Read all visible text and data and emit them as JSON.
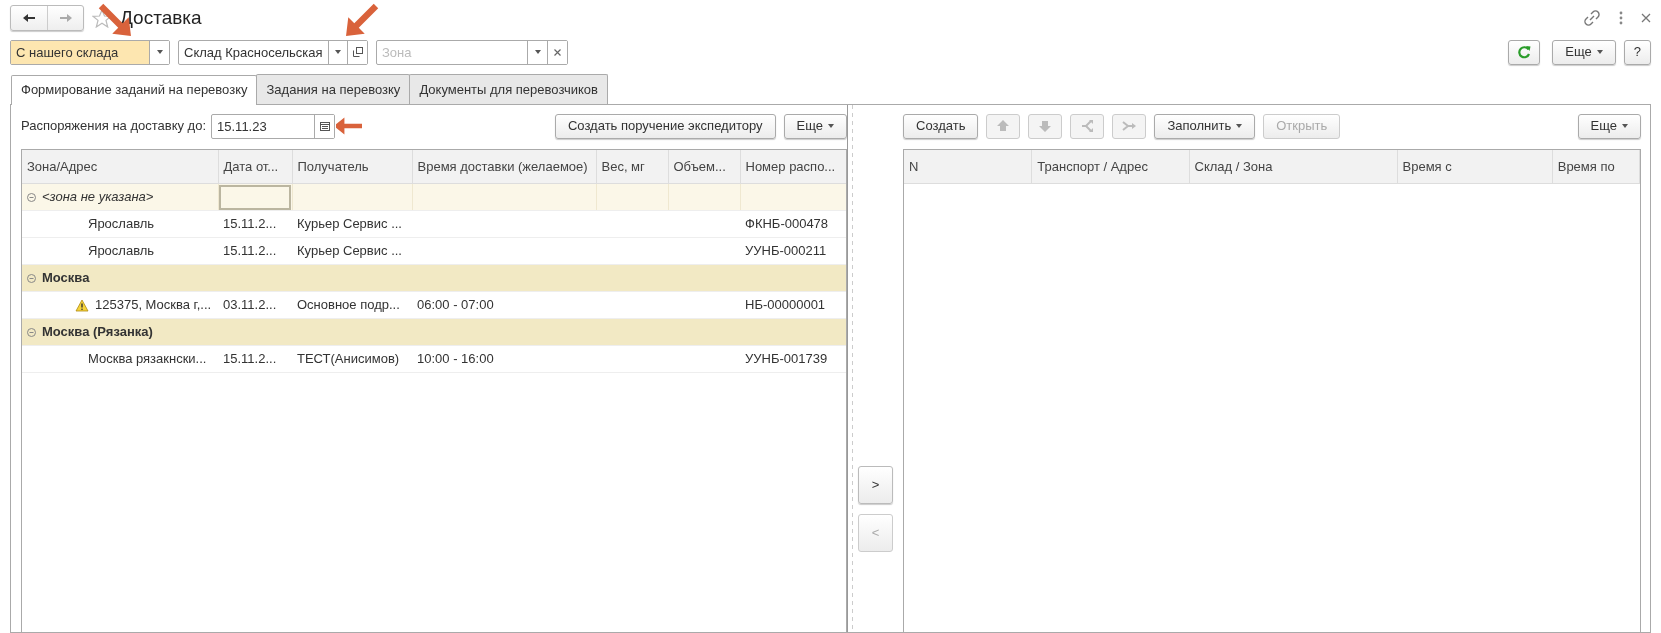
{
  "window": {
    "title": "Доставка",
    "back_enabled": true,
    "forward_enabled": false
  },
  "filters": [
    {
      "kind": "select",
      "value": "С нашего склада",
      "highlighted": true
    },
    {
      "kind": "select-open",
      "value": "Склад Красносельская",
      "highlighted": false
    },
    {
      "kind": "select-clear",
      "placeholder": "Зона",
      "highlighted": false
    }
  ],
  "top_buttons": {
    "more": "Еще",
    "help": "?"
  },
  "tabs": [
    {
      "label": "Формирование заданий на перевозку",
      "selected": true
    },
    {
      "label": "Задания на перевозку",
      "selected": false
    },
    {
      "label": "Документы для перевозчиков",
      "selected": false
    }
  ],
  "orders": {
    "date_label": "Распоряжения на доставку до:",
    "date_value": "15.11.23",
    "create_button": "Создать поручение экспедитору",
    "more": "Еще",
    "table": {
      "columns": [
        "Зона/Адрес",
        "Дата от...",
        "Получатель",
        "Время доставки (желаемое)",
        "Вес, мг",
        "Объем...",
        "Номер распо..."
      ],
      "rows": [
        {
          "kind": "unspecified-group",
          "selected": true,
          "cells": [
            "<зона не указана>"
          ]
        },
        {
          "kind": "item",
          "warning": false,
          "cells": [
            "Ярославль",
            "15.11.2...",
            "Курьер Сервис ...",
            "",
            "",
            "",
            "ФКНБ-000478"
          ]
        },
        {
          "kind": "item",
          "warning": false,
          "cells": [
            "Ярославль",
            "15.11.2...",
            "Курьер Сервис ...",
            "",
            "",
            "",
            "УУНБ-000211"
          ]
        },
        {
          "kind": "group",
          "selected": false,
          "cells": [
            "Москва"
          ]
        },
        {
          "kind": "item",
          "warning": true,
          "cells": [
            "125375, Москва г,...",
            "03.11.2...",
            "Основное подр...",
            "06:00 - 07:00",
            "",
            "",
            "НБ-00000001"
          ]
        },
        {
          "kind": "group",
          "selected": false,
          "cells": [
            "Москва (Рязанка)"
          ]
        },
        {
          "kind": "item",
          "warning": false,
          "cells": [
            "Москва рязакнски...",
            "15.11.2...",
            "ТЕСТ(Анисимов)",
            "10:00 - 16:00",
            "",
            "",
            "УУНБ-001739"
          ]
        }
      ]
    }
  },
  "transfer_buttons": [
    {
      "label": ">",
      "disabled": false
    },
    {
      "label": "<",
      "disabled": true
    }
  ],
  "tasks": {
    "toolbar": [
      {
        "kind": "button",
        "label": "Создать",
        "disabled": false
      },
      {
        "kind": "icon",
        "disabled": true
      },
      {
        "kind": "icon",
        "disabled": true
      },
      {
        "kind": "icon",
        "disabled": true
      },
      {
        "kind": "icon",
        "disabled": true
      },
      {
        "kind": "dropdown",
        "label": "Заполнить",
        "disabled": false
      },
      {
        "kind": "button",
        "label": "Открыть",
        "disabled": true
      }
    ],
    "more": "Еще",
    "table": {
      "columns": [
        "N",
        "Транспорт / Адрес",
        "Склад / Зона",
        "Время с",
        "Время по"
      ]
    }
  }
}
